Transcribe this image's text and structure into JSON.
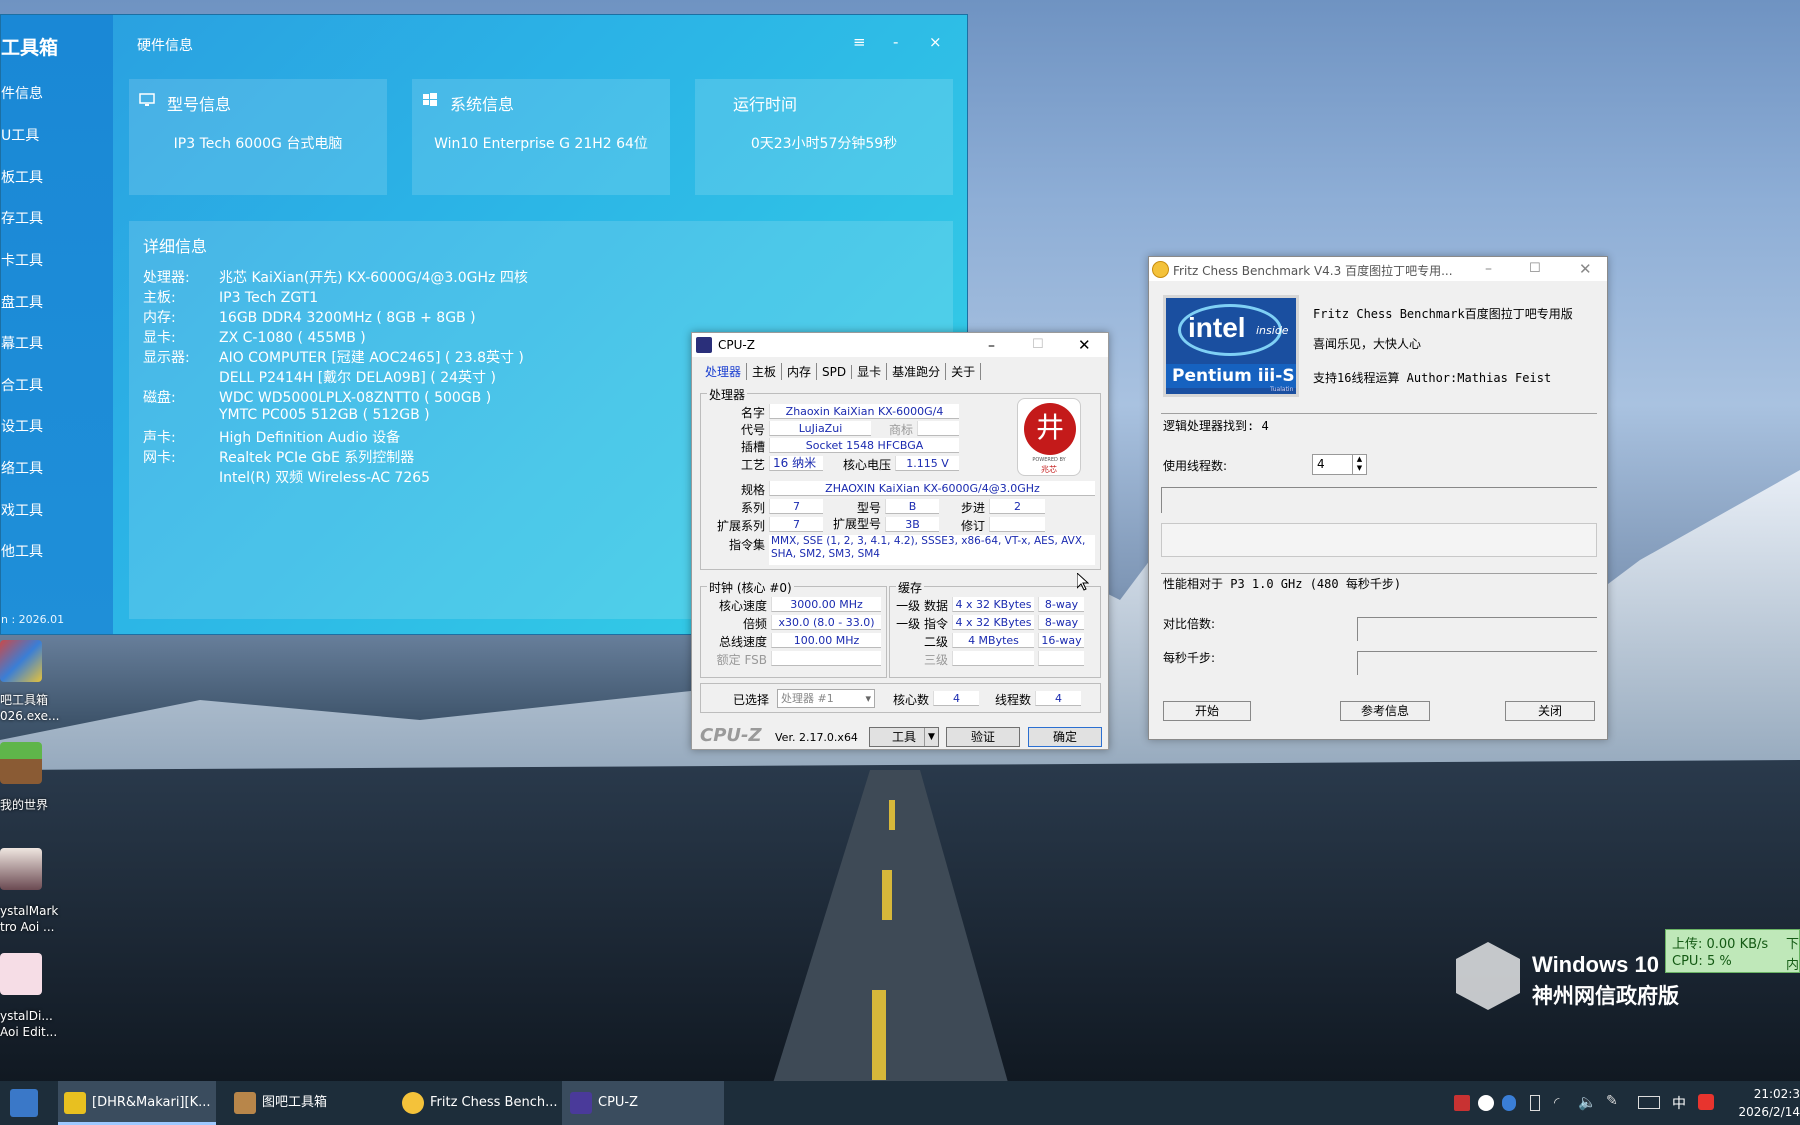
{
  "toolbox": {
    "brand": "工具箱",
    "window_title": "硬件信息",
    "nav": [
      "件信息",
      "U工具",
      "板工具",
      "存工具",
      "卡工具",
      "盘工具",
      "幕工具",
      "合工具",
      "设工具",
      "络工具",
      "戏工具",
      "他工具"
    ],
    "version": "n : 2026.01",
    "controls": {
      "menu": "≡",
      "minimize": "-",
      "close": "×"
    },
    "cards": [
      {
        "title": "型号信息",
        "value": "IP3 Tech 6000G 台式电脑",
        "icon": "monitor-icon"
      },
      {
        "title": "系统信息",
        "value": "Win10 Enterprise G 21H2 64位",
        "icon": "windows-icon"
      },
      {
        "title": "运行时间",
        "value": "0天23小时57分钟59秒",
        "icon": "clock-icon"
      }
    ],
    "detail": {
      "title": "详细信息",
      "rows": [
        {
          "k": "处理器:",
          "v": "兆芯 KaiXian(开先) KX-6000G/4@3.0GHz 四核"
        },
        {
          "k": "主板:",
          "v": "IP3 Tech ZGT1"
        },
        {
          "k": "内存:",
          "v": "16GB DDR4 3200MHz ( 8GB + 8GB )"
        },
        {
          "k": "显卡:",
          "v": "ZX C-1080 ( 455MB )"
        },
        {
          "k": "显示器:",
          "v": "AIO COMPUTER [冠建 AOC2465] ( 23.8英寸 )"
        },
        {
          "k": "",
          "v": "DELL P2414H [戴尔 DELA09B] ( 24英寸 )"
        },
        {
          "k": "磁盘:",
          "v": "WDC WD5000LPLX-08ZNTT0 ( 500GB )"
        },
        {
          "k": "",
          "v": "YMTC PC005 512GB ( 512GB )"
        },
        {
          "k": "声卡:",
          "v": "High Definition Audio 设备"
        },
        {
          "k": "网卡:",
          "v": "Realtek PCIe GbE 系列控制器"
        },
        {
          "k": "",
          "v": "Intel(R) 双频 Wireless-AC 7265"
        }
      ]
    }
  },
  "cpuz": {
    "title": "CPU-Z",
    "tabs": [
      "处理器",
      "主板",
      "内存",
      "SPD",
      "显卡",
      "基准跑分",
      "关于"
    ],
    "processor_group": "处理器",
    "name_label": "名字",
    "name": "Zhaoxin KaiXian KX-6000G/4",
    "codename_label": "代号",
    "codename": "LuJiaZui",
    "brand_label": "商标",
    "package_label": "插槽",
    "package": "Socket 1548 HFCBGA",
    "tech_label": "工艺",
    "tech": "16 纳米",
    "voltage_label": "核心电压",
    "voltage": "1.115 V",
    "spec_label": "规格",
    "spec": "ZHAOXIN KaiXian KX-6000G/4@3.0GHz",
    "family_label": "系列",
    "family": "7",
    "model_label": "型号",
    "model": "B",
    "stepping_label": "步进",
    "stepping": "2",
    "extfamily_label": "扩展系列",
    "extfamily": "7",
    "extmodel_label": "扩展型号",
    "extmodel": "3B",
    "revision_label": "修订",
    "instr_label": "指令集",
    "instr": "MMX, SSE (1, 2, 3, 4.1, 4.2), SSSE3, x86-64, VT-x, AES, AVX, SHA, SM2, SM3, SM4",
    "logo_text": "兆芯",
    "logo_powered": "POWERED BY",
    "clocks_group": "时钟 (核心 #0)",
    "core_speed_label": "核心速度",
    "core_speed": "3000.00 MHz",
    "multiplier_label": "倍频",
    "multiplier": "x30.0 (8.0 - 33.0)",
    "bus_label": "总线速度",
    "bus": "100.00 MHz",
    "fsb_label": "额定 FSB",
    "cache_group": "缓存",
    "l1d_label": "一级 数据",
    "l1d": "4 x 32 KBytes",
    "l1d_way": "8-way",
    "l1i_label": "一级 指令",
    "l1i": "4 x 32 KBytes",
    "l1i_way": "8-way",
    "l2_label": "二级",
    "l2": "4 MBytes",
    "l2_way": "16-way",
    "l3_label": "三级",
    "selection_label": "已选择",
    "selection": "处理器 #1",
    "cores_label": "核心数",
    "cores": "4",
    "threads_label": "线程数",
    "threads": "4",
    "footer_brand": "CPU-Z",
    "footer_version": "Ver. 2.17.0.x64",
    "tools_btn": "工具",
    "validate_btn": "验证",
    "ok_btn": "确定"
  },
  "fritz": {
    "title": "Fritz Chess Benchmark V4.3   百度图拉丁吧专用...",
    "header_line1": "Fritz Chess Benchmark百度图拉丁吧专用版",
    "header_line2": "喜闻乐见，大快人心",
    "header_line3": "支持16线程运算   Author:Mathias Feist",
    "badge_top": "intel",
    "badge_inside": "inside",
    "badge_bottom": "Pentium iii-S",
    "badge_small": "Tualatin",
    "logical_found": "逻辑处理器找到: 4",
    "threads_label": "使用线程数:",
    "threads_value": "4",
    "perf_line": "性能相对于 P3 1.0 GHz (480 每秒千步)",
    "ratio_label": "对比倍数:",
    "kns_label": "每秒千步:",
    "start_btn": "开始",
    "ref_btn": "参考信息",
    "close_btn": "关闭"
  },
  "desktop": {
    "icons": [
      {
        "label": "吧工具箱\n026.exe..."
      },
      {
        "label": "我的世界"
      },
      {
        "label": "ystalMark\ntro Aoi ..."
      },
      {
        "label": "ystalDi...\nAoi Edit..."
      }
    ],
    "netmon": {
      "upload": "上传: 0.00 KB/s",
      "cpu": "CPU: 5 %",
      "right1": "下",
      "right2": "内"
    },
    "watermark1": "Windows 10",
    "watermark2": "神州网信政府版"
  },
  "taskbar": {
    "items": [
      "[DHR&Makari][K...",
      "图吧工具箱",
      "Fritz Chess Bench...",
      "CPU-Z"
    ],
    "ime": "中",
    "time": "21:02:3",
    "date": "2026/2/14"
  }
}
